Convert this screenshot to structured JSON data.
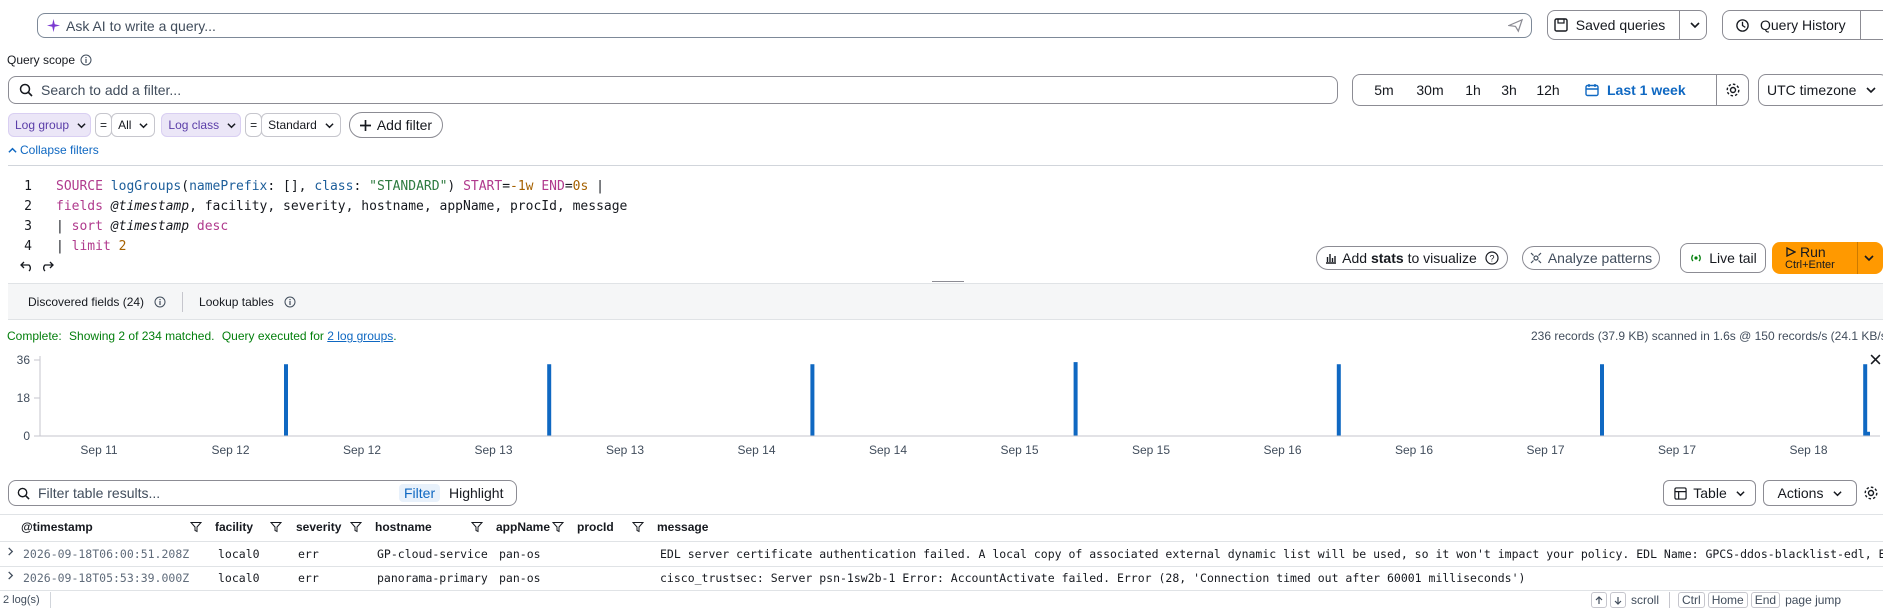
{
  "ask_ai": {
    "placeholder": "Ask AI to write a query..."
  },
  "header_buttons": {
    "saved_queries": "Saved queries",
    "query_history": "Query History"
  },
  "query_scope": {
    "label": "Query scope"
  },
  "search": {
    "placeholder": "Search to add a filter..."
  },
  "time_range": {
    "options": [
      "5m",
      "30m",
      "1h",
      "3h",
      "12h"
    ],
    "selected": "Last 1 week",
    "timezone": "UTC timezone"
  },
  "filters": [
    {
      "key": "Log group",
      "op": "=",
      "value": "All"
    },
    {
      "key": "Log class",
      "op": "=",
      "value": "Standard"
    }
  ],
  "add_filter": "Add filter",
  "collapse_filters": "Collapse filters",
  "editor": {
    "line_numbers": [
      "1",
      "2",
      "3",
      "4"
    ],
    "lines": [
      "SOURCE logGroups(namePrefix: [], class: \"STANDARD\") START=-1w END=0s |",
      "fields @timestamp, facility, severity, hostname, appName, procId, message",
      "| sort @timestamp desc",
      "| limit 2"
    ]
  },
  "actions": {
    "add_stats_pre": "Add",
    "add_stats_bold": "stats",
    "add_stats_post": "to visualize",
    "analyze_patterns": "Analyze patterns",
    "live_tail": "Live tail",
    "run": "Run",
    "run_shortcut": "Ctrl+Enter"
  },
  "tabs": {
    "discovered_fields": "Discovered fields (24)",
    "lookup_tables": "Lookup tables"
  },
  "status": {
    "complete": "Complete:",
    "showing": "Showing 2 of 234 matched.",
    "executed_prefix": "Query executed for",
    "log_groups_link": "2 log groups",
    "executed_suffix": ".",
    "records": "236 records (37.9 KB) scanned in 1.6s @ 150 records/s (24.1 KB/s"
  },
  "chart_data": {
    "type": "bar",
    "y_ticks": [
      "36",
      "18",
      "0"
    ],
    "ylim": [
      0,
      36
    ],
    "x_tick_labels": [
      "Sep 11",
      "Sep 12",
      "Sep 12",
      "Sep 13",
      "Sep 13",
      "Sep 14",
      "Sep 14",
      "Sep 15",
      "Sep 15",
      "Sep 16",
      "Sep 16",
      "Sep 17",
      "Sep 17",
      "Sep 18"
    ],
    "bars": [
      {
        "x": "Sep 12",
        "y": 34
      },
      {
        "x": "Sep 13",
        "y": 34
      },
      {
        "x": "Sep 14",
        "y": 34
      },
      {
        "x": "Sep 15",
        "y": 35
      },
      {
        "x": "Sep 16",
        "y": 34
      },
      {
        "x": "Sep 17",
        "y": 34
      },
      {
        "x": "Sep 18",
        "y": 34
      },
      {
        "x": "Sep 18",
        "y": 2
      }
    ],
    "bar_color": "#0f68c2",
    "grid": false
  },
  "table_toolbar": {
    "filter_placeholder": "Filter table results...",
    "filter_tab": "Filter",
    "highlight_tab": "Highlight",
    "view": "Table",
    "actions": "Actions"
  },
  "table": {
    "columns": [
      "@timestamp",
      "facility",
      "severity",
      "hostname",
      "appName",
      "procId",
      "message"
    ],
    "rows": [
      {
        "timestamp": "2026-09-18T06:00:51.208Z",
        "facility": "local0",
        "severity": "err",
        "hostname": "GP-cloud-service",
        "appName": "pan-os",
        "procId": "",
        "message": "EDL server certificate authentication failed. A local copy of associated external dynamic list will be used, so it won't impact your policy. EDL Name: GPCS-ddos-blacklist-edl, EDL Source"
      },
      {
        "timestamp": "2026-09-18T05:53:39.000Z",
        "facility": "local0",
        "severity": "err",
        "hostname": "panorama-primary",
        "appName": "pan-os",
        "procId": "",
        "message": "cisco_trustsec: Server psn-1sw2b-1 Error: AccountActivate failed. Error (28, 'Connection timed out after 60001 milliseconds')"
      }
    ]
  },
  "footer": {
    "count": "2 log(s)",
    "scroll": "scroll",
    "ctrl": "Ctrl",
    "home": "Home",
    "end": "End",
    "page_jump": "page jump"
  },
  "colors": {
    "accent": "#0f68c2",
    "run": "#ff9900",
    "pill_bg": "#ebe6f7",
    "success": "#037f0c",
    "link": "#0f68c2"
  }
}
